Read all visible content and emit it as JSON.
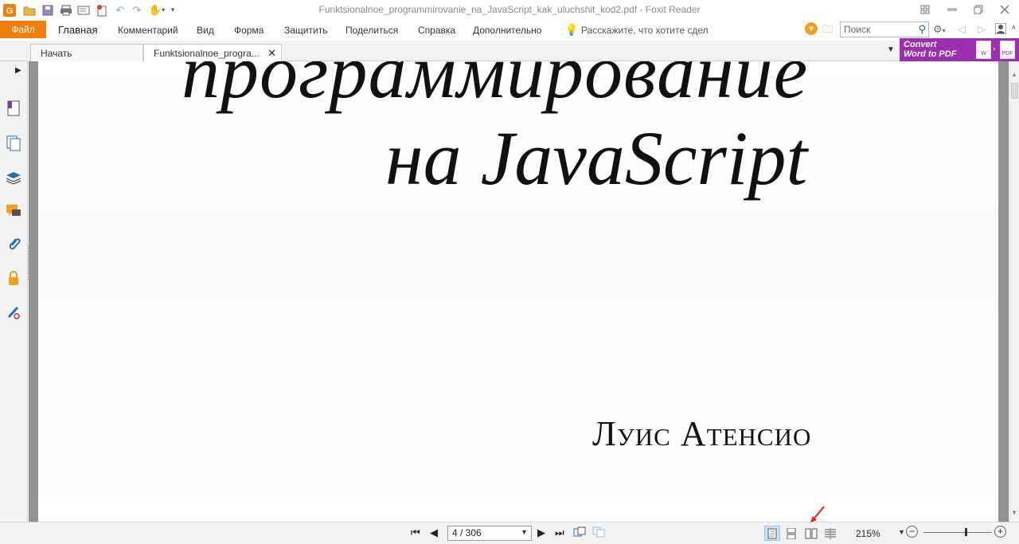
{
  "window": {
    "title": "Funktsionalnoe_programmirovanie_na_JavaScript_kak_uluchshit_kod2.pdf - Foxit Reader"
  },
  "menu": {
    "file": "Файл",
    "items": [
      "Главная",
      "Комментарий",
      "Вид",
      "Форма",
      "Защитить",
      "Поделиться",
      "Справка",
      "Дополнительно"
    ],
    "tell_me": "Расскажите, что хотите сдел"
  },
  "search": {
    "placeholder": "Поиск"
  },
  "tabs": [
    {
      "label": "Начать"
    },
    {
      "label": "Funktsionalnoe_progra..."
    }
  ],
  "promo": {
    "line1": "Convert",
    "line2": "Word to PDF"
  },
  "document": {
    "title_line1": "программирование",
    "title_line2": "на JavaScript",
    "author": "Луис Атенсио"
  },
  "status": {
    "page": "4 / 306",
    "zoom": "215%"
  },
  "colors": {
    "accent": "#f07f0b",
    "promo": "#9b2fae",
    "doc_background": "#939393"
  }
}
